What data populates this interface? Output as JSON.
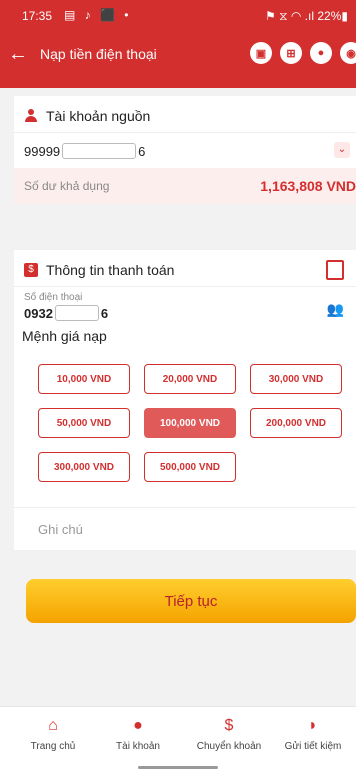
{
  "status_bar": {
    "time": "17:35",
    "icons": "▤ ♪ ⬛ •",
    "right": "⚑ ⧖ ◠ .ıl 22%▮"
  },
  "header": {
    "title": "Nạp tiền điện thoại",
    "back_icon": "←"
  },
  "source_account": {
    "title": "Tài khoản nguồn",
    "account_prefix": "99999",
    "account_suffix": "6",
    "balance_label": "Số dư khả dụng",
    "balance_value": "1,163,808 VND"
  },
  "payment": {
    "title": "Thông tin thanh toán",
    "phone_label": "Số điện thoại",
    "phone_prefix": "0932",
    "phone_suffix": "6"
  },
  "denomination": {
    "label": "Mệnh giá nạp",
    "options": [
      "10,000 VND",
      "20,000 VND",
      "30,000 VND",
      "50,000 VND",
      "100,000 VND",
      "200,000 VND",
      "300,000 VND",
      "500,000 VND"
    ],
    "selected": "100,000 VND"
  },
  "note": {
    "placeholder": "Ghi chú"
  },
  "cta": {
    "label": "Tiếp tục"
  },
  "bottom_nav": [
    {
      "label": "Trang chủ",
      "icon": "home-icon"
    },
    {
      "label": "Tài khoản",
      "icon": "user-icon"
    },
    {
      "label": "Chuyển khoản",
      "icon": "transfer-icon"
    },
    {
      "label": "Gửi tiết kiệm",
      "icon": "piggy-bank-icon"
    }
  ],
  "colors": {
    "primary": "#d32f2f",
    "cta_top": "#ffce2e",
    "cta_bottom": "#f4a300",
    "selected_pill": "#e05a5a"
  }
}
